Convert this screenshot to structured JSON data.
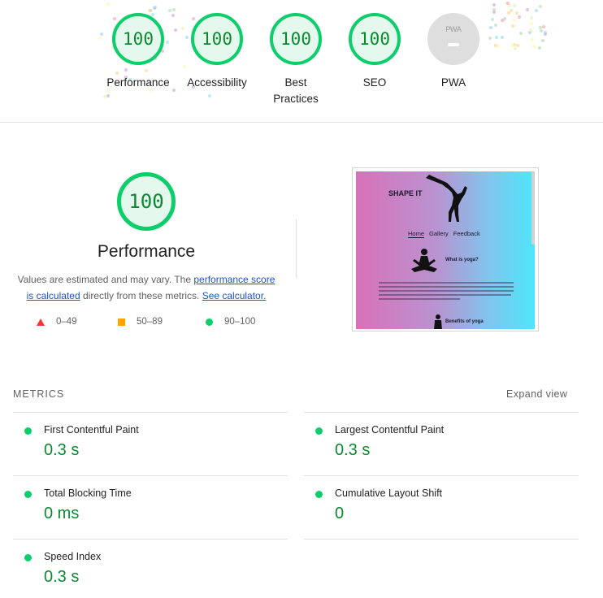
{
  "categories": [
    {
      "label": "Performance",
      "score": "100"
    },
    {
      "label": "Accessibility",
      "score": "100"
    },
    {
      "label": "Best Practices",
      "score": "100"
    },
    {
      "label": "SEO",
      "score": "100"
    },
    {
      "label": "PWA",
      "badge": "PWA"
    }
  ],
  "performance": {
    "score": "100",
    "title": "Performance",
    "desc_1": "Values are estimated and may vary. The ",
    "link_score": "performance score is calculated",
    "desc_2": " directly from these metrics. ",
    "link_calc": "See calculator.",
    "legend": [
      {
        "range": "0–49",
        "color": "#ff3333"
      },
      {
        "range": "50–89",
        "color": "#ffa400"
      },
      {
        "range": "90–100",
        "color": "#0cce6b"
      }
    ]
  },
  "thumbnail": {
    "brand": "SHAPE IT",
    "nav": [
      "Home",
      "Gallery",
      "Feedback"
    ],
    "heading1": "What is yoga?",
    "heading2": "Benefits of yoga"
  },
  "metrics": {
    "header": "METRICS",
    "expand_label": "Expand view",
    "items": [
      {
        "name": "First Contentful Paint",
        "value": "0.3 s"
      },
      {
        "name": "Largest Contentful Paint",
        "value": "0.3 s"
      },
      {
        "name": "Total Blocking Time",
        "value": "0 ms"
      },
      {
        "name": "Cumulative Layout Shift",
        "value": "0"
      },
      {
        "name": "Speed Index",
        "value": "0.3 s"
      }
    ]
  },
  "colors": {
    "pass": "#0cce6b",
    "pass_text": "#0a8a2f",
    "average": "#ffa400",
    "fail": "#ff3333"
  }
}
